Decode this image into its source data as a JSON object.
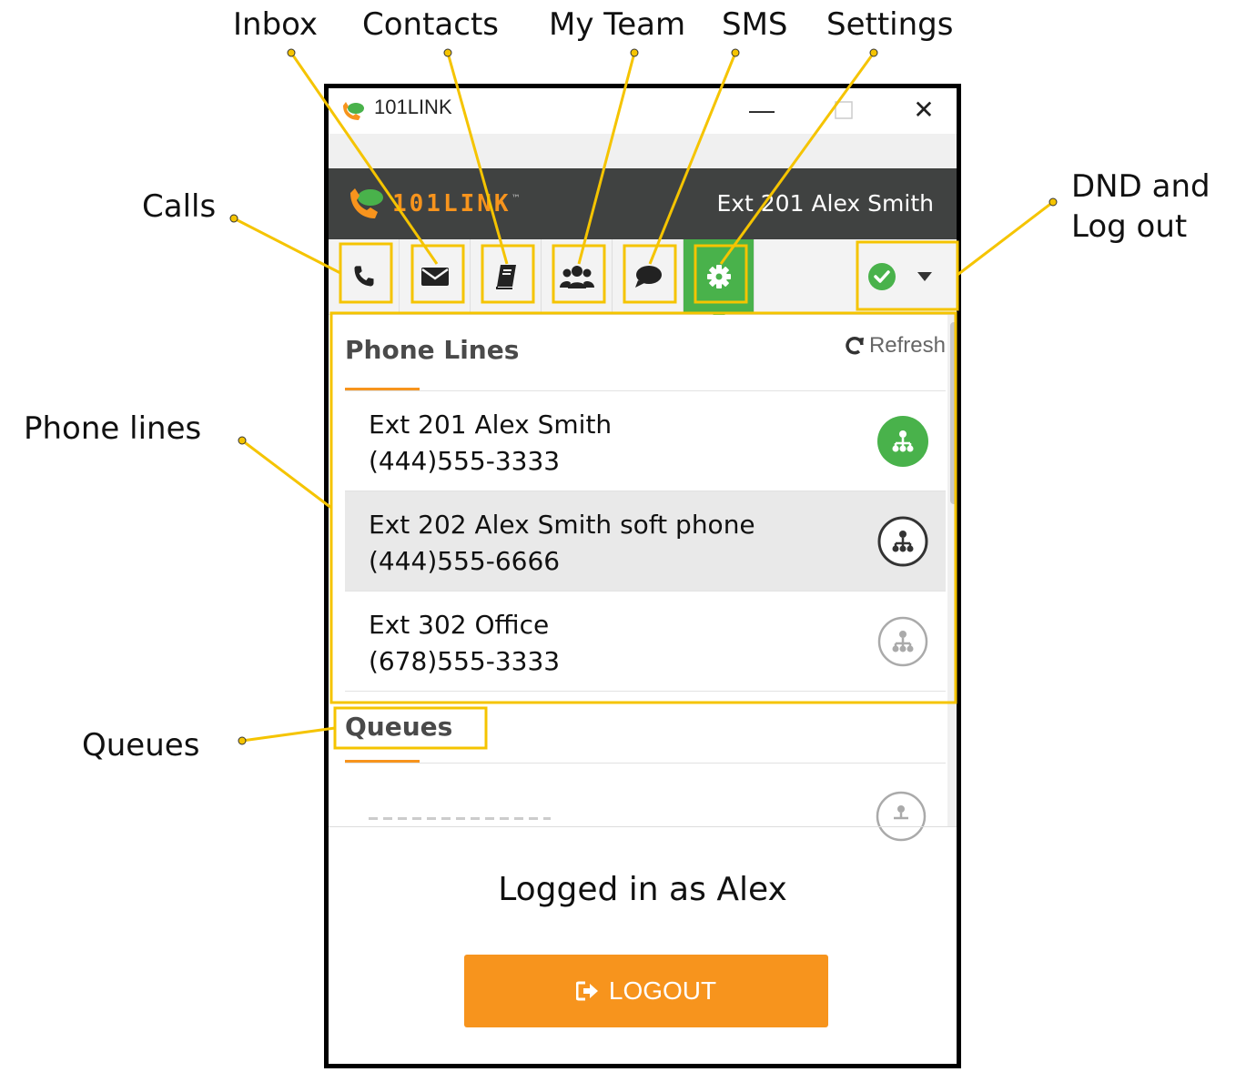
{
  "callouts": {
    "inbox": "Inbox",
    "contacts": "Contacts",
    "my_team": "My Team",
    "sms": "SMS",
    "settings": "Settings",
    "calls": "Calls",
    "dnd_line1": "DND and",
    "dnd_line2": "Log out",
    "phone_lines": "Phone lines",
    "queues": "Queues"
  },
  "window": {
    "title": "101LINK",
    "minimize": "—",
    "close": "✕"
  },
  "header": {
    "logo_text": "101LINK",
    "logo_tm": "™",
    "user": "Ext 201 Alex Smith"
  },
  "tabs": [
    {
      "name": "calls",
      "icon": "phone-icon",
      "active": false
    },
    {
      "name": "inbox",
      "icon": "envelope-icon",
      "active": false
    },
    {
      "name": "contacts",
      "icon": "book-icon",
      "active": false
    },
    {
      "name": "my-team",
      "icon": "users-icon",
      "active": false
    },
    {
      "name": "sms",
      "icon": "chat-bubble-icon",
      "active": false
    },
    {
      "name": "settings",
      "icon": "gear-icon",
      "active": true
    }
  ],
  "phone_lines": {
    "title": "Phone Lines",
    "refresh_label": "Refresh",
    "lines": [
      {
        "name": "Ext 201 Alex Smith",
        "number": "(444)555-3333",
        "status": "active"
      },
      {
        "name": "Ext 202 Alex Smith soft phone",
        "number": "(444)555-6666",
        "status": "available"
      },
      {
        "name": "Ext 302 Office",
        "number": "(678)555-3333",
        "status": "inactive"
      }
    ]
  },
  "queues": {
    "title": "Queues"
  },
  "footer": {
    "logged_in": "Logged in as Alex",
    "logout_label": "LOGOUT"
  },
  "colors": {
    "accent_orange": "#f7941d",
    "active_green": "#49b24b",
    "header_dark": "#404241",
    "callout_yellow": "#f5c400"
  }
}
